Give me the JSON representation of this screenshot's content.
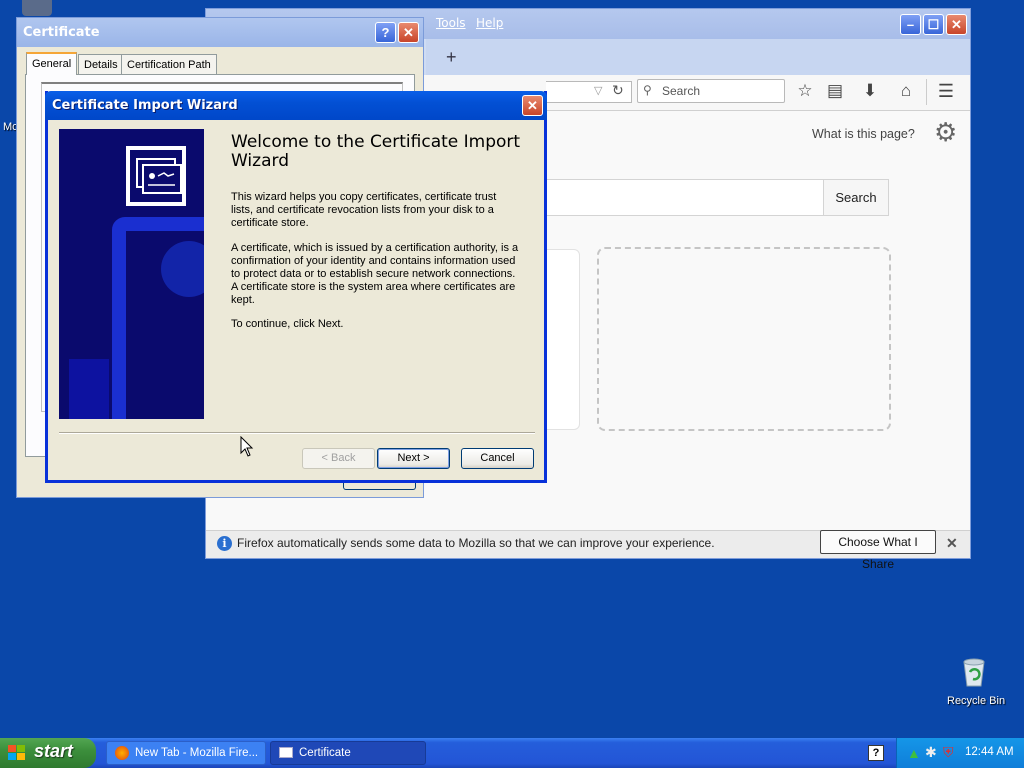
{
  "desktop": {
    "partial_icon_label": "Mc",
    "recycle_bin_label": "Recycle Bin"
  },
  "firefox": {
    "menu": {
      "tools": "Tools",
      "help": "Help"
    },
    "search_placeholder": "Search",
    "what_is_this_page": "What is this page?",
    "search_button": "Search",
    "notification": {
      "text": "Firefox automatically sends some data to Mozilla so that we can improve your experience.",
      "share_button": "Choose What I Share"
    }
  },
  "certificate": {
    "title": "Certificate",
    "tabs": [
      "General",
      "Details",
      "Certification Path"
    ]
  },
  "wizard": {
    "title": "Certificate Import Wizard",
    "heading": "Welcome to the Certificate Import Wizard",
    "para1": "This wizard helps you copy certificates, certificate trust lists, and certificate revocation lists from your disk to a certificate store.",
    "para2": "A certificate, which is issued by a certification authority, is a confirmation of your identity and contains information used to protect data or to establish secure network connections. A certificate store is the system area where certificates are kept.",
    "para3": "To continue, click Next.",
    "buttons": {
      "back": "< Back",
      "next": "Next >",
      "cancel": "Cancel"
    }
  },
  "taskbar": {
    "start": "start",
    "tasks": [
      "New Tab - Mozilla Fire...",
      "Certificate"
    ],
    "clock": "12:44 AM"
  },
  "colors": {
    "desktop": "#0a47a9",
    "xp_title_blue": "#0350d4",
    "xp_close_red": "#d2491f",
    "wizard_banner": "#0a0a6d"
  }
}
